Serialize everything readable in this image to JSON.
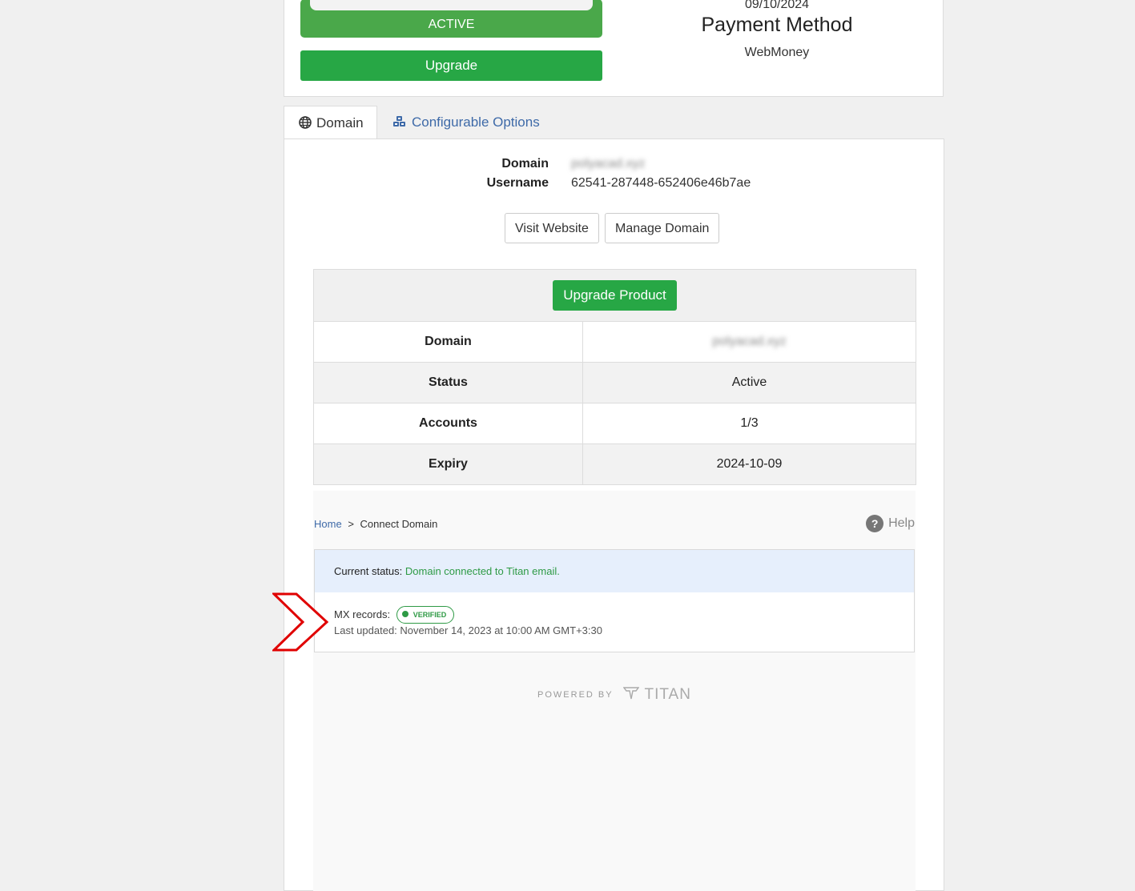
{
  "top": {
    "status_label": "ACTIVE",
    "upgrade_label": "Upgrade",
    "date": "09/10/2024",
    "payment_method_title": "Payment Method",
    "payment_method_value": "WebMoney"
  },
  "tabs": [
    {
      "label": "Domain",
      "icon": "globe-icon",
      "active": true
    },
    {
      "label": "Configurable Options",
      "icon": "cubes-icon",
      "active": false
    }
  ],
  "domain_info": {
    "domain_label": "Domain",
    "domain_value": "polyacad.xyz",
    "username_label": "Username",
    "username_value": "62541-287448-652406e46b7ae"
  },
  "actions": {
    "visit_website": "Visit Website",
    "manage_domain": "Manage Domain"
  },
  "product_table": {
    "upgrade_button": "Upgrade Product",
    "rows": [
      {
        "key": "Domain",
        "value": "polyacad.xyz"
      },
      {
        "key": "Status",
        "value": "Active"
      },
      {
        "key": "Accounts",
        "value": "1/3"
      },
      {
        "key": "Expiry",
        "value": "2024-10-09"
      }
    ]
  },
  "titan": {
    "breadcrumb_home": "Home",
    "breadcrumb_sep": ">",
    "breadcrumb_current": "Connect Domain",
    "help_label": "Help",
    "current_status_label": "Current status:",
    "current_status_value": "Domain connected to Titan email.",
    "mx_label": "MX records:",
    "mx_badge": "VERIFIED",
    "last_updated": "Last updated: November 14, 2023 at 10:00 AM GMT+3:30",
    "powered_by": "POWERED BY",
    "brand": "TITAN"
  },
  "colors": {
    "primary_green": "#27a745",
    "status_green": "#4aa84a",
    "verified_green": "#2e9a45",
    "link_blue": "#3e6aa8",
    "annotation_red": "#e00000"
  }
}
